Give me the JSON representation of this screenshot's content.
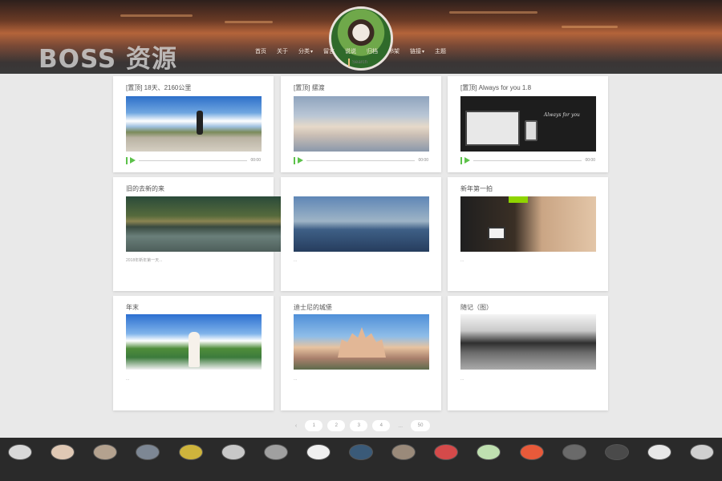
{
  "header": {
    "watermark": "BOSS 资源",
    "nav": [
      {
        "label": "首页",
        "dropdown": false
      },
      {
        "label": "关于",
        "dropdown": false
      },
      {
        "label": "分类",
        "dropdown": true
      },
      {
        "label": "留言",
        "dropdown": false
      },
      {
        "label": "说说",
        "dropdown": false
      },
      {
        "label": "归档",
        "dropdown": false
      },
      {
        "label": "书架",
        "dropdown": false
      },
      {
        "label": "链接",
        "dropdown": true
      },
      {
        "label": "主题",
        "dropdown": false
      }
    ],
    "search_placeholder": "Search"
  },
  "posts": [
    {
      "title": "[置顶] 18天、2160公里",
      "date": "",
      "image": "road-trip-photo",
      "audio_time": "00:00"
    },
    {
      "title": "[置顶] 摆渡",
      "date": "",
      "image": "sky-photo",
      "audio_time": "00:00"
    },
    {
      "title": "[置顶] Always for you 1.8",
      "date": "",
      "image": "devices-screenshot",
      "image_caption": "Always for you",
      "audio_time": "00:00"
    },
    {
      "title": "旧的去新的来",
      "date": "",
      "image": "lake-photo",
      "excerpt": "2018年新年第一天..."
    },
    {
      "title": "",
      "date": "",
      "image": "coast-photo",
      "excerpt": "..."
    },
    {
      "title": "新年第一拍",
      "date": "",
      "image": "gym-photo",
      "excerpt": "..."
    },
    {
      "title": "年末",
      "date": "",
      "image": "woman-photo",
      "excerpt": "..."
    },
    {
      "title": "迪士尼的城堡",
      "date": "",
      "image": "castle-photo",
      "excerpt": "..."
    },
    {
      "title": "随记（图）",
      "date": "",
      "image": "bw-photo",
      "excerpt": "..."
    }
  ],
  "pagination": {
    "prev": "‹",
    "pages": [
      "1",
      "2",
      "3",
      "4"
    ],
    "ellipsis": "...",
    "last": "50",
    "next": "›"
  },
  "footer": {
    "friend_count": 17
  },
  "colors": {
    "accent": "#5cc14a",
    "page_bg": "#e9e9e9",
    "footer_bg": "#2a2a2a"
  }
}
